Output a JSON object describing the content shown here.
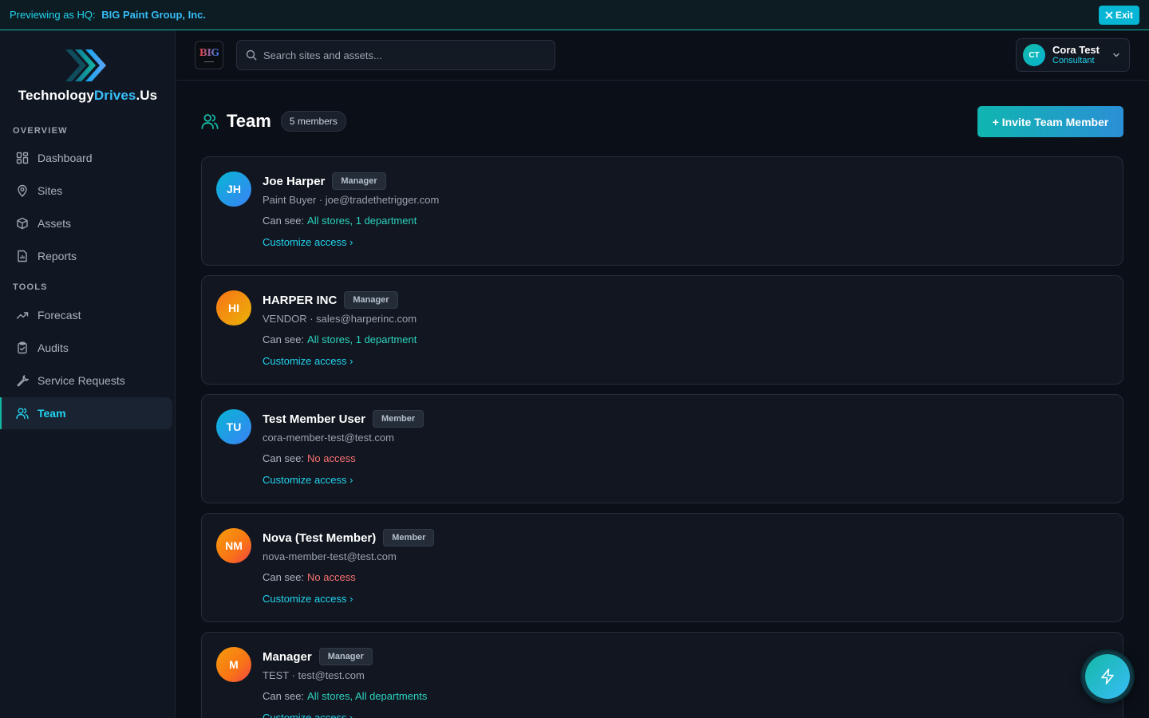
{
  "banner": {
    "prefix": "Previewing as HQ:",
    "org_name": "BIG Paint Group, Inc.",
    "exit_label": "Exit"
  },
  "brand": {
    "name_part1": "Technology",
    "name_part2": "Drives",
    "name_part3": ".Us",
    "accent": "#38bdf8"
  },
  "sidebar": {
    "overview_label": "OVERVIEW",
    "tools_label": "TOOLS",
    "items": [
      {
        "label": "Dashboard",
        "icon": "dashboard-grid-icon"
      },
      {
        "label": "Sites",
        "icon": "map-pin-icon"
      },
      {
        "label": "Assets",
        "icon": "box-icon"
      },
      {
        "label": "Reports",
        "icon": "file-report-icon"
      },
      {
        "label": "Forecast",
        "icon": "trend-up-icon"
      },
      {
        "label": "Audits",
        "icon": "clipboard-check-icon"
      },
      {
        "label": "Service Requests",
        "icon": "wrench-icon"
      },
      {
        "label": "Team",
        "icon": "users-icon",
        "active": true
      }
    ]
  },
  "topbar": {
    "org_logo_text": "BIG",
    "search_placeholder": "Search sites and assets...",
    "user": {
      "initials": "CT",
      "name": "Cora Test",
      "role": "Consultant"
    }
  },
  "page": {
    "title": "Team",
    "count": "5 members",
    "invite_label": "+ Invite Team Member"
  },
  "members": [
    {
      "initials": "JH",
      "name": "Joe Harper",
      "role": "Manager",
      "subtitle": "Paint Buyer · joe@tradethetrigger.com",
      "can_see_label": "Can see:",
      "access": "All stores, 1 department",
      "access_ok": true,
      "link": "Customize access ›"
    },
    {
      "initials": "HI",
      "name": "HARPER INC",
      "role": "Manager",
      "subtitle": "VENDOR · sales@harperinc.com",
      "can_see_label": "Can see:",
      "access": "All stores, 1 department",
      "access_ok": true,
      "link": "Customize access ›"
    },
    {
      "initials": "TU",
      "name": "Test Member User",
      "role": "Member",
      "subtitle": "cora-member-test@test.com",
      "can_see_label": "Can see:",
      "access": "No access",
      "access_ok": false,
      "link": "Customize access ›"
    },
    {
      "initials": "NM",
      "name": "Nova (Test Member)",
      "role": "Member",
      "subtitle": "nova-member-test@test.com",
      "can_see_label": "Can see:",
      "access": "No access",
      "access_ok": false,
      "link": "Customize access ›"
    },
    {
      "initials": "M",
      "name": "Manager",
      "role": "Manager",
      "subtitle": "TEST · test@test.com",
      "can_see_label": "Can see:",
      "access": "All stores, All departments",
      "access_ok": true,
      "link": "Customize access ›"
    }
  ],
  "fab": {
    "icon": "lightning-icon"
  }
}
